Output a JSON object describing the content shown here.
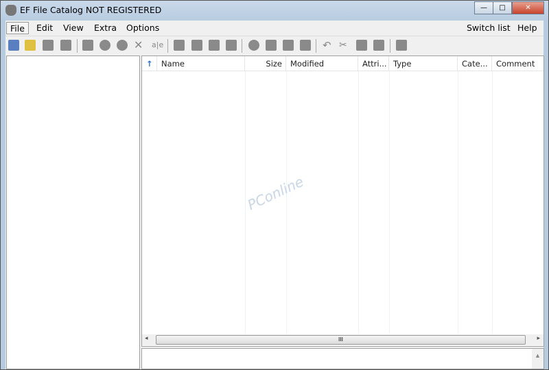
{
  "window": {
    "title": "EF File Catalog NOT REGISTERED",
    "minimize": "—",
    "maximize": "□",
    "close": "✕"
  },
  "menu": {
    "left": [
      "File",
      "Edit",
      "View",
      "Extra",
      "Options"
    ],
    "right": [
      "Switch list",
      "Help"
    ]
  },
  "toolbar": {
    "icons": [
      "new-catalog-icon",
      "open-icon",
      "save-icon",
      "save-all-icon",
      "add-disk-icon",
      "update-disk-icon",
      "delete-disk-icon",
      "delete-icon",
      "rename-icon",
      "catalog-icon",
      "folder-icon",
      "edit-icon",
      "open-folder-icon",
      "search-icon",
      "find-icon",
      "find-next-icon",
      "find-drive-icon",
      "undo-icon",
      "cut-icon",
      "copy-icon",
      "paste-icon",
      "properties-icon"
    ]
  },
  "filelist": {
    "sort_icon": "↑",
    "columns": [
      "Name",
      "Size",
      "Modified",
      "Attri...",
      "Type",
      "Cate...",
      "Comment"
    ]
  },
  "scrollbar": {
    "left": "◂",
    "right": "▸",
    "grip": "III",
    "up": "▲"
  },
  "watermark": "PConline"
}
